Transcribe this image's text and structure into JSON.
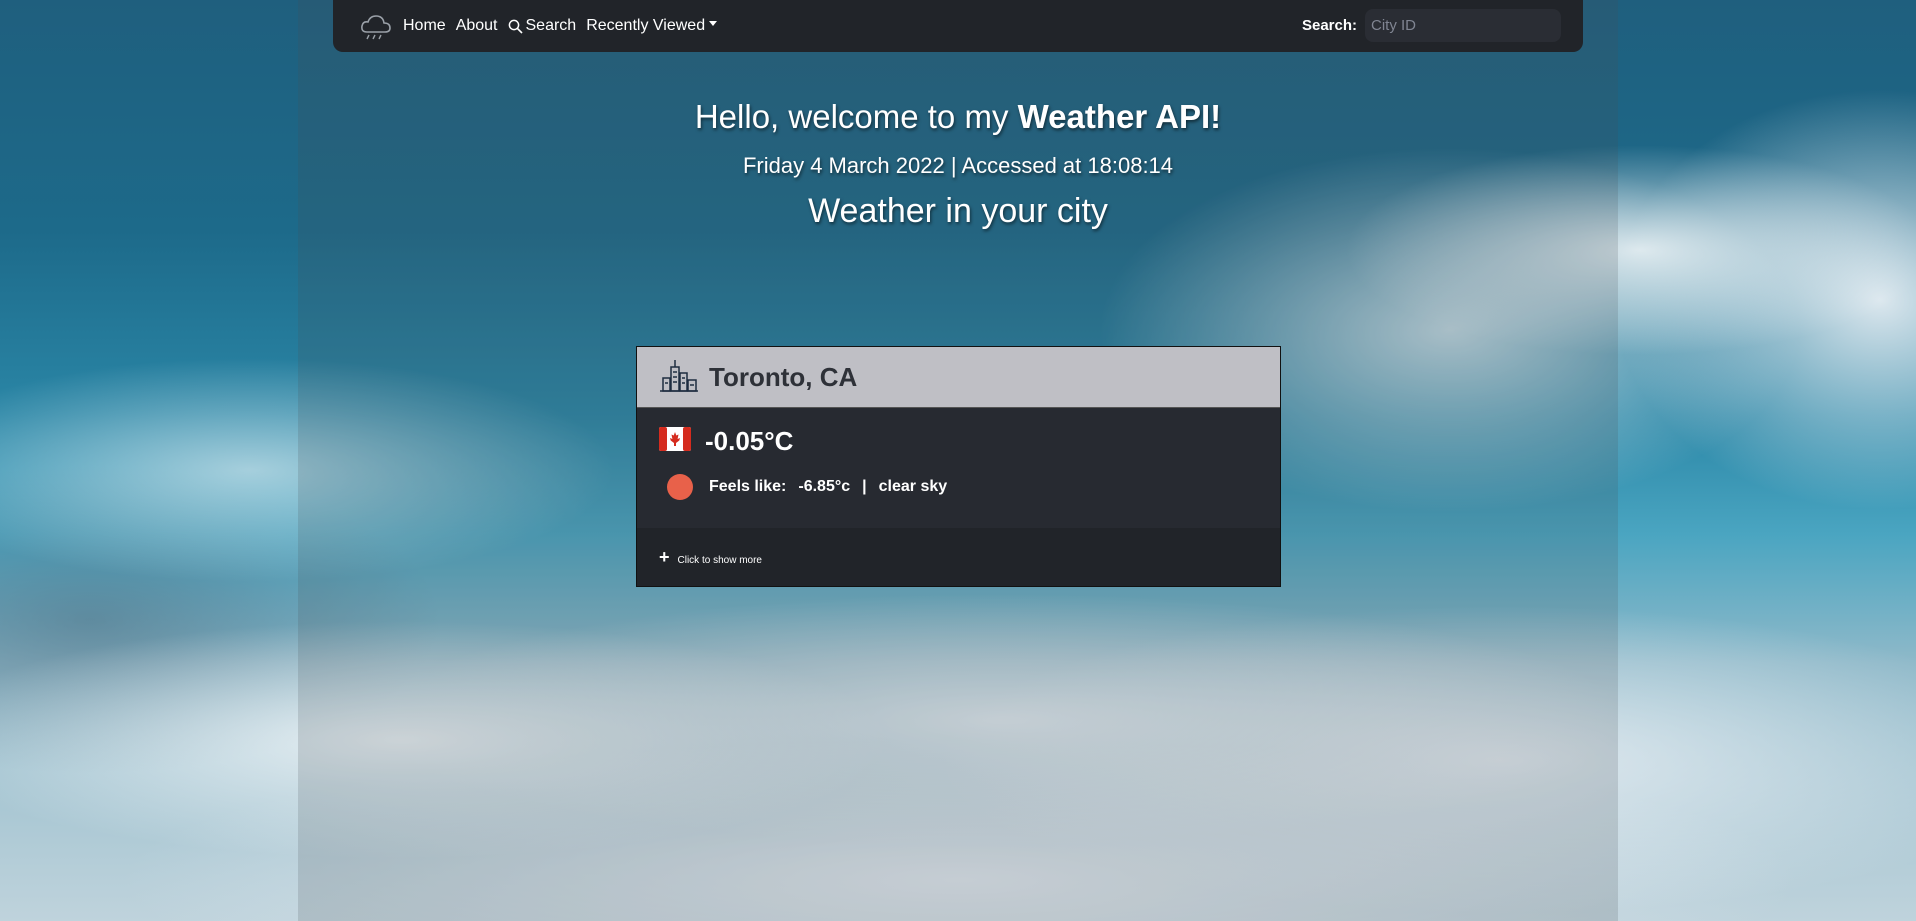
{
  "nav": {
    "home_label": "Home",
    "about_label": "About",
    "search_label": "Search",
    "recent_label": "Recently Viewed",
    "search_field_label": "Search:",
    "search_placeholder": "City ID"
  },
  "hero": {
    "greeting": "Hello, welcome to my ",
    "greeting_bold": "Weather API!",
    "date_line": "Friday 4 March 2022 | Accessed at 18:08:14",
    "subtitle": "Weather in your city"
  },
  "card": {
    "city": "Toronto, CA",
    "temperature": "-0.05°C",
    "feels_label": "Feels like:",
    "feels_value": "-6.85°c",
    "separator": "|",
    "condition": "clear sky",
    "show_more": "Click to show more",
    "status_color": "#e8614a"
  },
  "colors": {
    "navbar": "#212429",
    "card_body": "#272a31"
  }
}
